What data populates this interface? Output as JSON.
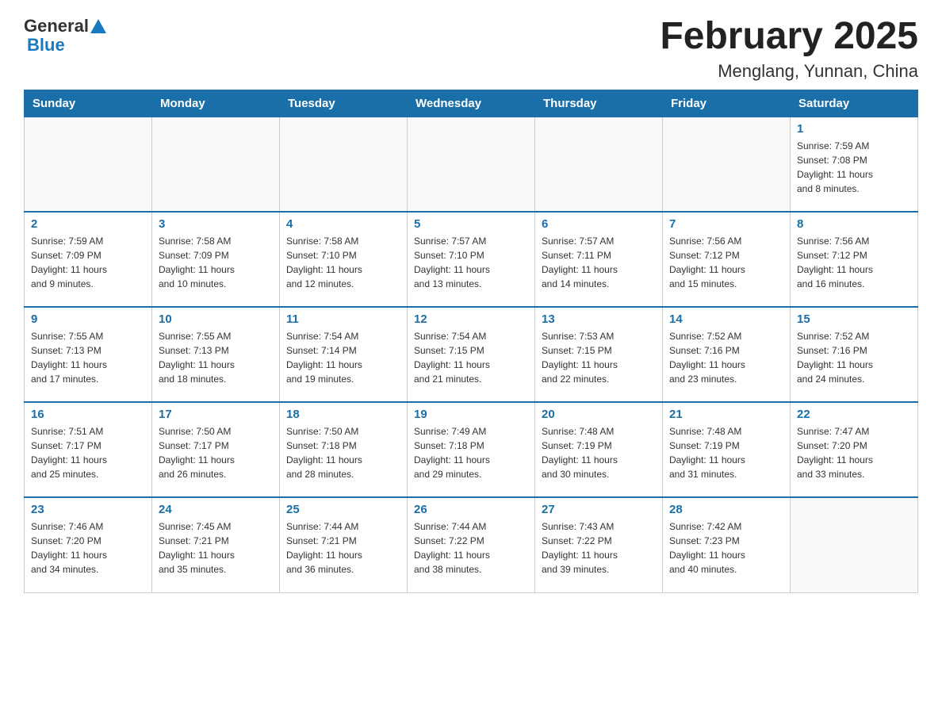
{
  "header": {
    "logo_general": "General",
    "logo_blue": "Blue",
    "title": "February 2025",
    "subtitle": "Menglang, Yunnan, China"
  },
  "weekdays": [
    "Sunday",
    "Monday",
    "Tuesday",
    "Wednesday",
    "Thursday",
    "Friday",
    "Saturday"
  ],
  "weeks": [
    [
      {
        "day": "",
        "info": ""
      },
      {
        "day": "",
        "info": ""
      },
      {
        "day": "",
        "info": ""
      },
      {
        "day": "",
        "info": ""
      },
      {
        "day": "",
        "info": ""
      },
      {
        "day": "",
        "info": ""
      },
      {
        "day": "1",
        "info": "Sunrise: 7:59 AM\nSunset: 7:08 PM\nDaylight: 11 hours\nand 8 minutes."
      }
    ],
    [
      {
        "day": "2",
        "info": "Sunrise: 7:59 AM\nSunset: 7:09 PM\nDaylight: 11 hours\nand 9 minutes."
      },
      {
        "day": "3",
        "info": "Sunrise: 7:58 AM\nSunset: 7:09 PM\nDaylight: 11 hours\nand 10 minutes."
      },
      {
        "day": "4",
        "info": "Sunrise: 7:58 AM\nSunset: 7:10 PM\nDaylight: 11 hours\nand 12 minutes."
      },
      {
        "day": "5",
        "info": "Sunrise: 7:57 AM\nSunset: 7:10 PM\nDaylight: 11 hours\nand 13 minutes."
      },
      {
        "day": "6",
        "info": "Sunrise: 7:57 AM\nSunset: 7:11 PM\nDaylight: 11 hours\nand 14 minutes."
      },
      {
        "day": "7",
        "info": "Sunrise: 7:56 AM\nSunset: 7:12 PM\nDaylight: 11 hours\nand 15 minutes."
      },
      {
        "day": "8",
        "info": "Sunrise: 7:56 AM\nSunset: 7:12 PM\nDaylight: 11 hours\nand 16 minutes."
      }
    ],
    [
      {
        "day": "9",
        "info": "Sunrise: 7:55 AM\nSunset: 7:13 PM\nDaylight: 11 hours\nand 17 minutes."
      },
      {
        "day": "10",
        "info": "Sunrise: 7:55 AM\nSunset: 7:13 PM\nDaylight: 11 hours\nand 18 minutes."
      },
      {
        "day": "11",
        "info": "Sunrise: 7:54 AM\nSunset: 7:14 PM\nDaylight: 11 hours\nand 19 minutes."
      },
      {
        "day": "12",
        "info": "Sunrise: 7:54 AM\nSunset: 7:15 PM\nDaylight: 11 hours\nand 21 minutes."
      },
      {
        "day": "13",
        "info": "Sunrise: 7:53 AM\nSunset: 7:15 PM\nDaylight: 11 hours\nand 22 minutes."
      },
      {
        "day": "14",
        "info": "Sunrise: 7:52 AM\nSunset: 7:16 PM\nDaylight: 11 hours\nand 23 minutes."
      },
      {
        "day": "15",
        "info": "Sunrise: 7:52 AM\nSunset: 7:16 PM\nDaylight: 11 hours\nand 24 minutes."
      }
    ],
    [
      {
        "day": "16",
        "info": "Sunrise: 7:51 AM\nSunset: 7:17 PM\nDaylight: 11 hours\nand 25 minutes."
      },
      {
        "day": "17",
        "info": "Sunrise: 7:50 AM\nSunset: 7:17 PM\nDaylight: 11 hours\nand 26 minutes."
      },
      {
        "day": "18",
        "info": "Sunrise: 7:50 AM\nSunset: 7:18 PM\nDaylight: 11 hours\nand 28 minutes."
      },
      {
        "day": "19",
        "info": "Sunrise: 7:49 AM\nSunset: 7:18 PM\nDaylight: 11 hours\nand 29 minutes."
      },
      {
        "day": "20",
        "info": "Sunrise: 7:48 AM\nSunset: 7:19 PM\nDaylight: 11 hours\nand 30 minutes."
      },
      {
        "day": "21",
        "info": "Sunrise: 7:48 AM\nSunset: 7:19 PM\nDaylight: 11 hours\nand 31 minutes."
      },
      {
        "day": "22",
        "info": "Sunrise: 7:47 AM\nSunset: 7:20 PM\nDaylight: 11 hours\nand 33 minutes."
      }
    ],
    [
      {
        "day": "23",
        "info": "Sunrise: 7:46 AM\nSunset: 7:20 PM\nDaylight: 11 hours\nand 34 minutes."
      },
      {
        "day": "24",
        "info": "Sunrise: 7:45 AM\nSunset: 7:21 PM\nDaylight: 11 hours\nand 35 minutes."
      },
      {
        "day": "25",
        "info": "Sunrise: 7:44 AM\nSunset: 7:21 PM\nDaylight: 11 hours\nand 36 minutes."
      },
      {
        "day": "26",
        "info": "Sunrise: 7:44 AM\nSunset: 7:22 PM\nDaylight: 11 hours\nand 38 minutes."
      },
      {
        "day": "27",
        "info": "Sunrise: 7:43 AM\nSunset: 7:22 PM\nDaylight: 11 hours\nand 39 minutes."
      },
      {
        "day": "28",
        "info": "Sunrise: 7:42 AM\nSunset: 7:23 PM\nDaylight: 11 hours\nand 40 minutes."
      },
      {
        "day": "",
        "info": ""
      }
    ]
  ]
}
